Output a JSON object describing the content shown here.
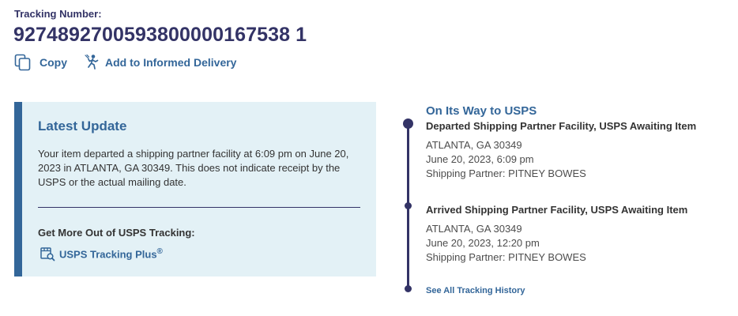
{
  "tracking": {
    "label": "Tracking Number:",
    "number": "9274892700593800000167538 1"
  },
  "actions": {
    "copy_label": "Copy",
    "informed_delivery_label": "Add to Informed Delivery"
  },
  "latest_update": {
    "title": "Latest Update",
    "text": "Your item departed a shipping partner facility at 6:09 pm on June 20, 2023 in ATLANTA, GA 30349. This does not indicate receipt by the USPS or the actual mailing date.",
    "more_title": "Get More Out of USPS Tracking:",
    "plus_label": "USPS Tracking Plus",
    "plus_mark": "®"
  },
  "timeline": {
    "status": "On Its Way to USPS",
    "events": [
      {
        "title": "Departed Shipping Partner Facility, USPS Awaiting Item",
        "location": "ATLANTA, GA 30349",
        "datetime": "June 20, 2023, 6:09 pm",
        "partner": "Shipping Partner: PITNEY BOWES"
      },
      {
        "title": "Arrived Shipping Partner Facility, USPS Awaiting Item",
        "location": "ATLANTA, GA 30349",
        "datetime": "June 20, 2023, 12:20 pm",
        "partner": "Shipping Partner: PITNEY BOWES"
      }
    ],
    "history_link": "See All Tracking History"
  },
  "icons": {
    "copy": "copy-icon",
    "informed_delivery": "mail-carrier-icon",
    "tracking_plus": "package-search-icon"
  },
  "colors": {
    "navy": "#333366",
    "link_blue": "#336699",
    "panel_bg": "#e3f1f6"
  }
}
